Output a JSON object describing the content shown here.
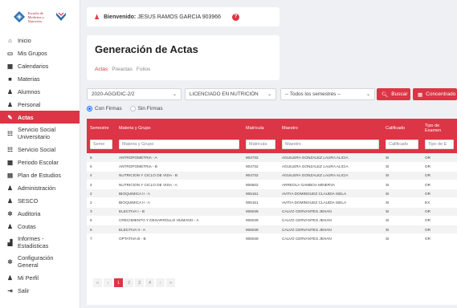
{
  "logo": {
    "text": "Escuela de Medicina y Nutrición"
  },
  "sidebar": {
    "items": [
      {
        "label": "Inicio",
        "icon": "home-icon",
        "glyph": "⌂"
      },
      {
        "label": "Mis Grupos",
        "icon": "monitor-icon",
        "glyph": "▭"
      },
      {
        "label": "Calendarios",
        "icon": "calendar-icon",
        "glyph": "▦"
      },
      {
        "label": "Materias",
        "icon": "book-icon",
        "glyph": "■"
      },
      {
        "label": "Alumnos",
        "icon": "users-icon",
        "glyph": "♟"
      },
      {
        "label": "Personal",
        "icon": "users-icon",
        "glyph": "♟"
      },
      {
        "label": "Actas",
        "icon": "pencil-icon",
        "glyph": "✎",
        "active": true
      },
      {
        "label": "Servicio Social Universitario",
        "icon": "table-icon",
        "glyph": "☷"
      },
      {
        "label": "Servicio Social",
        "icon": "table-icon",
        "glyph": "☷"
      },
      {
        "label": "Periodo Escolar",
        "icon": "calendar-icon",
        "glyph": "▦"
      },
      {
        "label": "Plan de Estudios",
        "icon": "list-icon",
        "glyph": "▤"
      },
      {
        "label": "Administración",
        "icon": "user-gear-icon",
        "glyph": "♟"
      },
      {
        "label": "SESCO",
        "icon": "user-gear-icon",
        "glyph": "♟"
      },
      {
        "label": "Auditoria",
        "icon": "gear-icon",
        "glyph": "✲"
      },
      {
        "label": "Coutas",
        "icon": "user-gear-icon",
        "glyph": "♟"
      },
      {
        "label": "Informes - Estadisticas",
        "icon": "chart-icon",
        "glyph": "▟"
      },
      {
        "label": "Configuración General",
        "icon": "gears-icon",
        "glyph": "✲"
      },
      {
        "label": "Mi Perfil",
        "icon": "user-icon",
        "glyph": "♟"
      },
      {
        "label": "Salir",
        "icon": "logout-icon",
        "glyph": "⇥"
      }
    ]
  },
  "header": {
    "welcome_label": "Bienvenido:",
    "user_name": "JESUS RAMOS GARCIA 903966",
    "help": "?"
  },
  "main": {
    "title": "Generación de Actas",
    "tabs": [
      {
        "label": "Actas",
        "active": true
      },
      {
        "label": "Preactas",
        "active": false
      },
      {
        "label": "Folios",
        "active": false
      }
    ]
  },
  "filters": {
    "period": "2020-AGO/DIC-2/2",
    "program": "LICENCIADO EN NUTRICIÓN",
    "semester": "-- Todos los semestres --",
    "search_label": "Buscar",
    "summary_label": "Concentrado"
  },
  "radios": [
    {
      "label": "Con Firmas",
      "checked": true
    },
    {
      "label": "Sin Firmas",
      "checked": false
    }
  ],
  "table": {
    "headers": [
      "Semestre",
      "Materia y Grupo",
      "Matrícula",
      "Maestro",
      "Calificado",
      "Tipo de Examen"
    ],
    "filter_placeholders": [
      "Seme",
      "Materia y Grupo",
      "Matricula",
      "Maestro",
      "Calificado",
      "Tipo de E"
    ],
    "rows": [
      [
        "6",
        "ANTROPOMETRIA - A",
        "904732",
        "AGUILERA GONZALEZ LAURA ALICIA",
        "SI",
        "OR"
      ],
      [
        "6",
        "ANTROPOMETRIA - B",
        "904732",
        "AGUILERA GONZALEZ LAURA ALICIA",
        "SI",
        "OR"
      ],
      [
        "4",
        "NUTRICION Y CICLO DE VIDA - B",
        "904732",
        "AGUILERA GONZALEZ LAURA ALICIA",
        "SI",
        "OR"
      ],
      [
        "4",
        "NUTRICION Y CICLO DE VIDA - A",
        "906502",
        "ARREOLA GAMBOA MINERVA",
        "SI",
        "OR"
      ],
      [
        "2",
        "BIOQUIMICA II - A",
        "906151",
        "AVITIA DOMINGUEZ CLAUDIA ISELA",
        "SI",
        "OR"
      ],
      [
        "2",
        "BIOQUIMICA II - A",
        "906151",
        "AVITIA DOMINGUEZ CLAUDIA ISELA",
        "SI",
        "EX"
      ],
      [
        "3",
        "ELECTIVA I - B",
        "906049",
        "CALVO CERVANTES JEHAN",
        "SI",
        "OR"
      ],
      [
        "6",
        "CRECIMIENTO Y DESARROLLO HUMANO - A",
        "906049",
        "CALVO CERVANTES JEHAN",
        "SI",
        "OR"
      ],
      [
        "6",
        "ELECTIVA II - A",
        "906049",
        "CALVO CERVANTES JEHAN",
        "SI",
        "OR"
      ],
      [
        "7",
        "OPTATIVA B - B",
        "906049",
        "CALVO CERVANTES JEHAN",
        "SI",
        "OR"
      ]
    ]
  },
  "pagination": {
    "first": "«",
    "prev": "‹",
    "pages": [
      "1",
      "2",
      "3",
      "4"
    ],
    "current": "1",
    "next": "›",
    "last": "»"
  },
  "colors": {
    "accent": "#dc3545",
    "background": "#eef0f4"
  }
}
